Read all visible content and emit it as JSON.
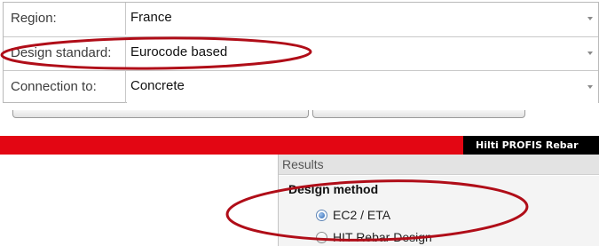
{
  "settings": {
    "rows": [
      {
        "label": "Region:",
        "value": "France"
      },
      {
        "label": "Design standard:",
        "value": "Eurocode based"
      },
      {
        "label": "Connection to:",
        "value": "Concrete"
      }
    ]
  },
  "header_bar": {
    "title": "Hilti PROFIS Rebar",
    "bar_color": "#e30613",
    "title_bg": "#000000"
  },
  "results": {
    "header": "Results",
    "section_title": "Design method",
    "options": [
      {
        "label": "EC2 / ETA",
        "selected": true
      },
      {
        "label": "HIT Rebar Design",
        "selected": false
      }
    ]
  },
  "annotation_color": "#b00d18",
  "icons": [
    "chevron-down-icon",
    "radio-checked-icon",
    "radio-unchecked-icon"
  ]
}
